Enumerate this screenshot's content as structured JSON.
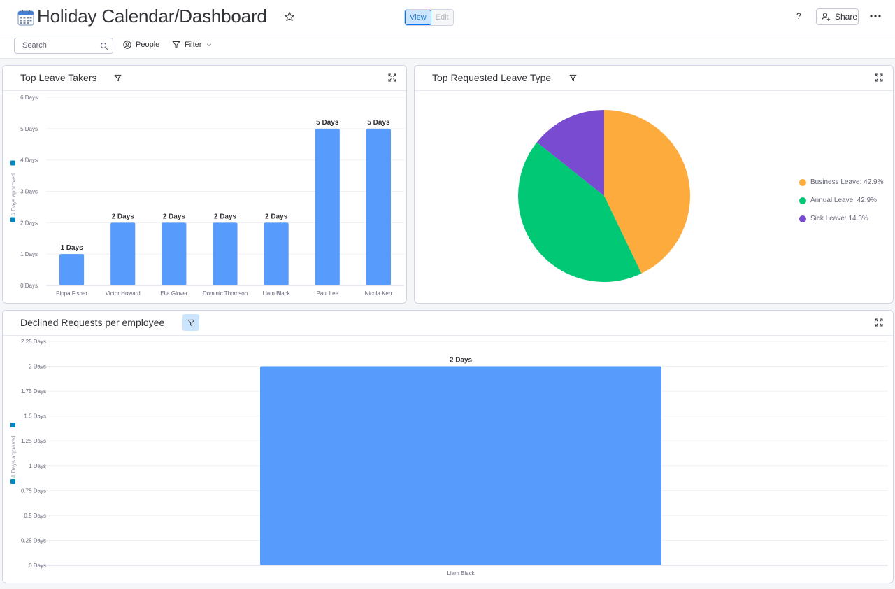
{
  "header": {
    "title": "Holiday Calendar/Dashboard",
    "view_label": "View",
    "edit_label": "Edit",
    "help_label": "?",
    "share_label": "Share"
  },
  "toolbar": {
    "search_placeholder": "Search",
    "people_label": "People",
    "filter_label": "Filter"
  },
  "colors": {
    "bar": "#579bfc",
    "accent": "#0073ea"
  },
  "widgets": {
    "top_leave_takers": {
      "title": "Top Leave Takers"
    },
    "top_leave_type": {
      "title": "Top Requested Leave Type"
    },
    "declined": {
      "title": "Declined Requests per employee"
    }
  },
  "chart_data": [
    {
      "type": "bar",
      "title": "Top Leave Takers",
      "ylabel": "# Days approved",
      "categories": [
        "Pippa Fisher",
        "Victor Howard",
        "Ella Glover",
        "Dominic Thomson",
        "Liam Black",
        "Paul Lee",
        "Nicola Kerr"
      ],
      "values": [
        1,
        2,
        2,
        2,
        2,
        5,
        5
      ],
      "data_labels": [
        "1 Days",
        "2 Days",
        "2 Days",
        "2 Days",
        "2 Days",
        "5 Days",
        "5 Days"
      ],
      "yticks": [
        "0 Days",
        "1 Days",
        "2 Days",
        "3 Days",
        "4 Days",
        "5 Days",
        "6 Days"
      ],
      "ylim": [
        0,
        6
      ],
      "grid": true,
      "color": "#579bfc"
    },
    {
      "type": "pie",
      "title": "Top Requested Leave Type",
      "slices": [
        {
          "label": "Business Leave: 42.9%",
          "value": 42.9,
          "color": "#fdab3d"
        },
        {
          "label": "Annual Leave: 42.9%",
          "value": 42.9,
          "color": "#00c875"
        },
        {
          "label": "Sick Leave: 14.3%",
          "value": 14.3,
          "color": "#784bd1"
        }
      ],
      "legend": "right"
    },
    {
      "type": "bar",
      "title": "Declined Requests per employee",
      "ylabel": "# Days approved",
      "categories": [
        "Liam Black"
      ],
      "values": [
        2
      ],
      "data_labels": [
        "2 Days"
      ],
      "yticks": [
        "0 Days",
        "0.25 Days",
        "0.5 Days",
        "0.75 Days",
        "1 Days",
        "1.25 Days",
        "1.5 Days",
        "1.75 Days",
        "2 Days",
        "2.25 Days"
      ],
      "ylim": [
        0,
        2.25
      ],
      "grid": true,
      "color": "#579bfc"
    }
  ]
}
